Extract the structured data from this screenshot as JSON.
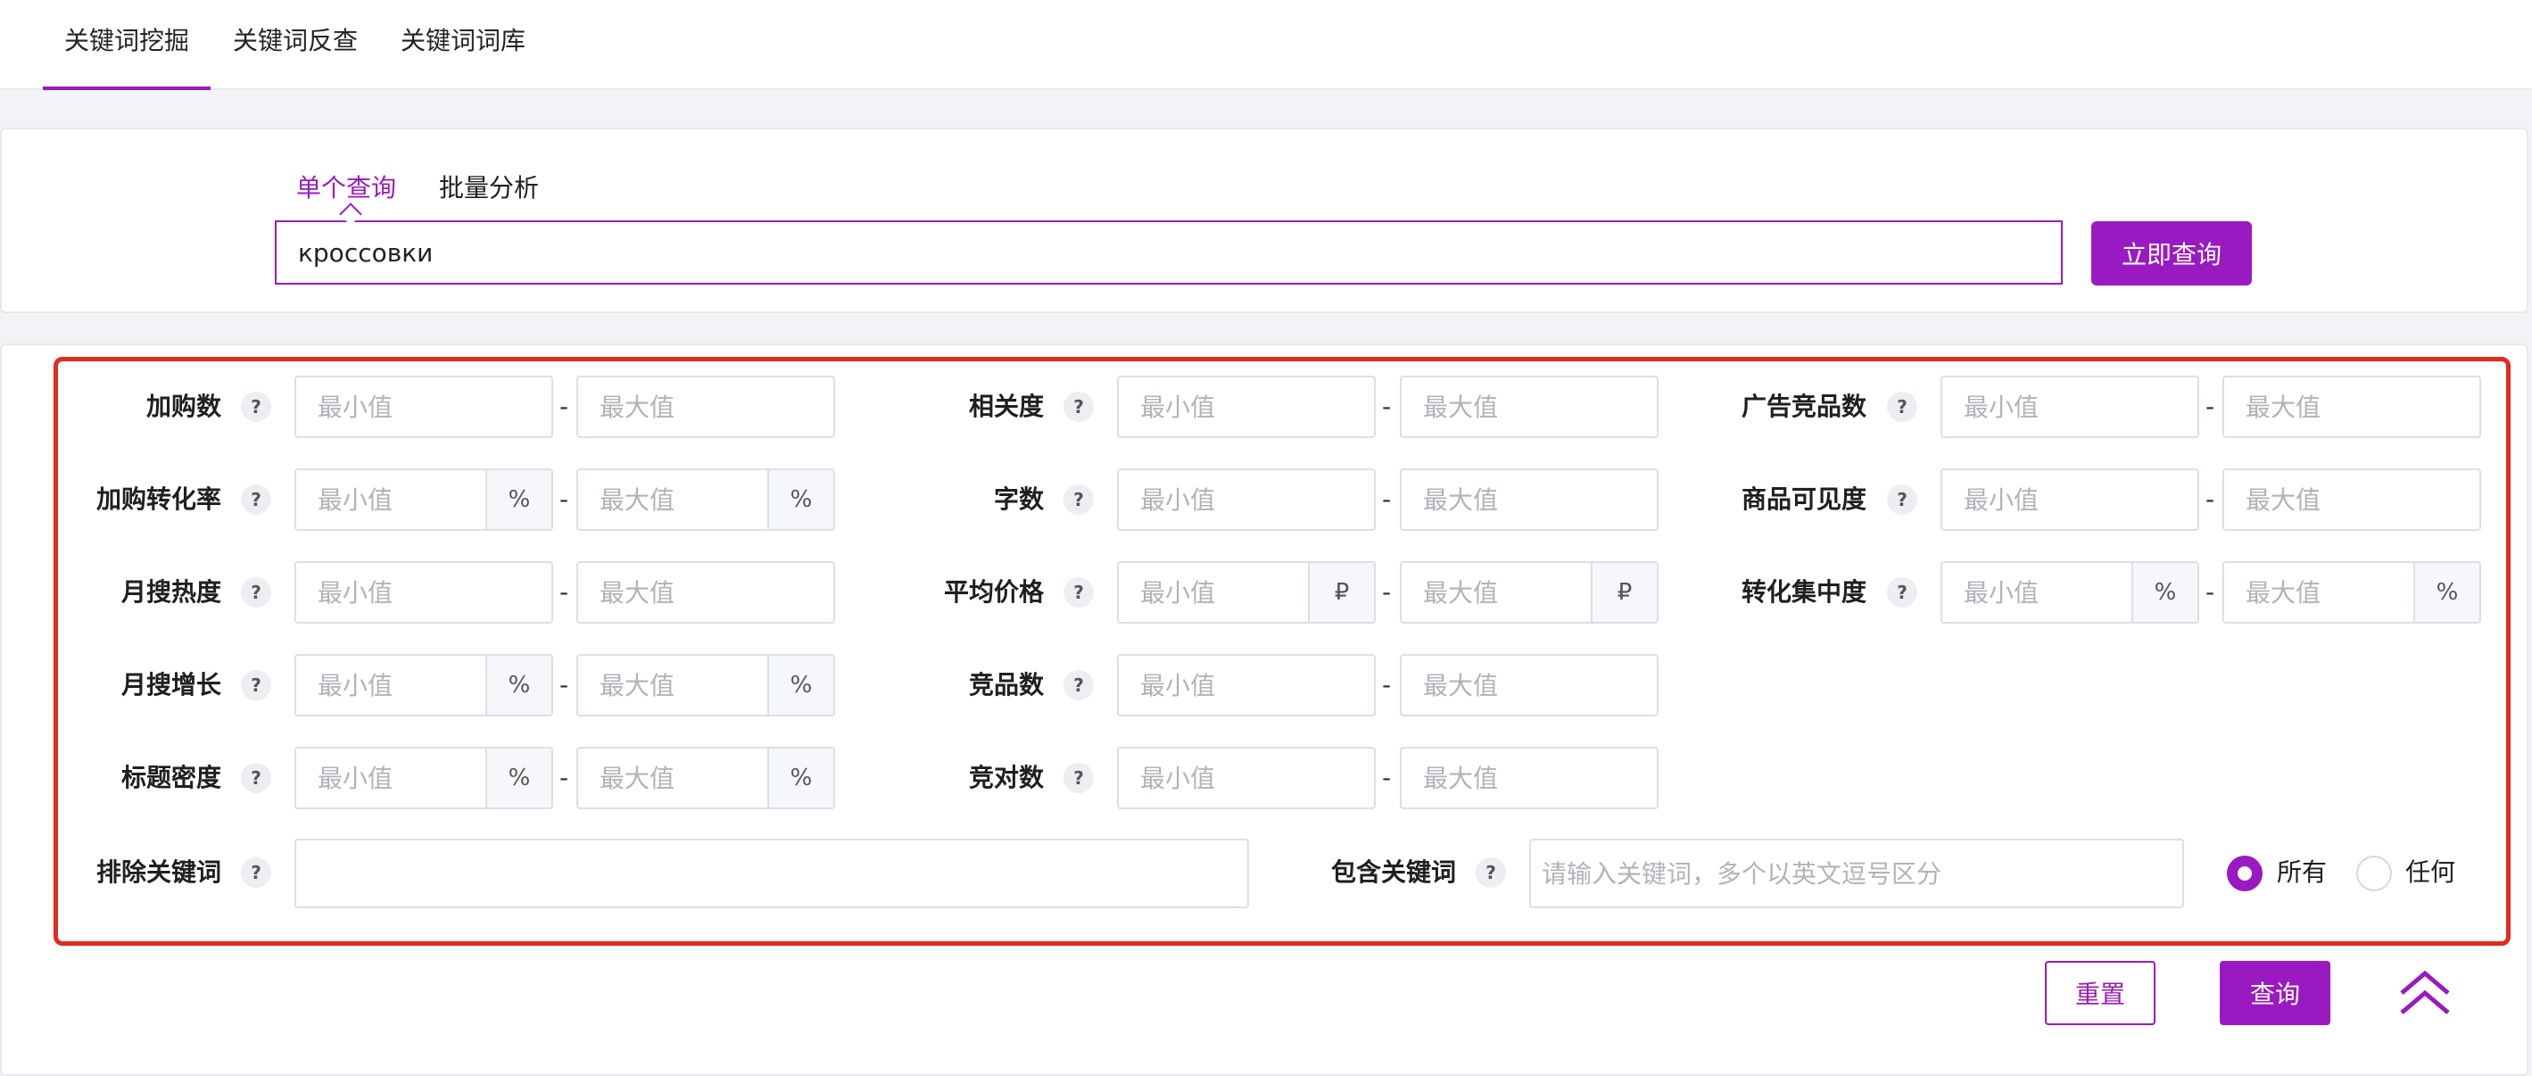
{
  "top_tabs": [
    "关键词挖掘",
    "关键词反查",
    "关键词词库"
  ],
  "search": {
    "tabs": [
      "单个查询",
      "批量分析"
    ],
    "query": "кроссовки",
    "submit_label": "立即查询"
  },
  "filters": {
    "min_placeholder": "最小值",
    "max_placeholder": "最大值",
    "help_glyph": "?",
    "dash": "-",
    "rows": {
      "add_to_cart": {
        "label": "加购数"
      },
      "add_to_cart_rate": {
        "label": "加购转化率",
        "unit": "%"
      },
      "monthly_heat": {
        "label": "月搜热度"
      },
      "monthly_growth": {
        "label": "月搜增长",
        "unit": "%"
      },
      "title_density": {
        "label": "标题密度",
        "unit": "%"
      },
      "relevance": {
        "label": "相关度"
      },
      "char_count": {
        "label": "字数"
      },
      "avg_price": {
        "label": "平均价格",
        "unit": "₽"
      },
      "competitors": {
        "label": "竞品数"
      },
      "bid_count": {
        "label": "竞对数"
      },
      "ad_competitors": {
        "label": "广告竞品数"
      },
      "visibility": {
        "label": "商品可见度"
      },
      "conversion_concentration": {
        "label": "转化集中度",
        "unit": "%"
      }
    },
    "exclude": {
      "label": "排除关键词",
      "value": ""
    },
    "include": {
      "label": "包含关键词",
      "placeholder": "请输入关键词，多个以英文逗号区分"
    },
    "match_mode": {
      "options": [
        "所有",
        "任何"
      ],
      "selected": "所有"
    }
  },
  "actions": {
    "reset_label": "重置",
    "query_label": "查询"
  },
  "colors": {
    "accent": "#9a1ac2",
    "highlight_border": "#e22a1e"
  }
}
